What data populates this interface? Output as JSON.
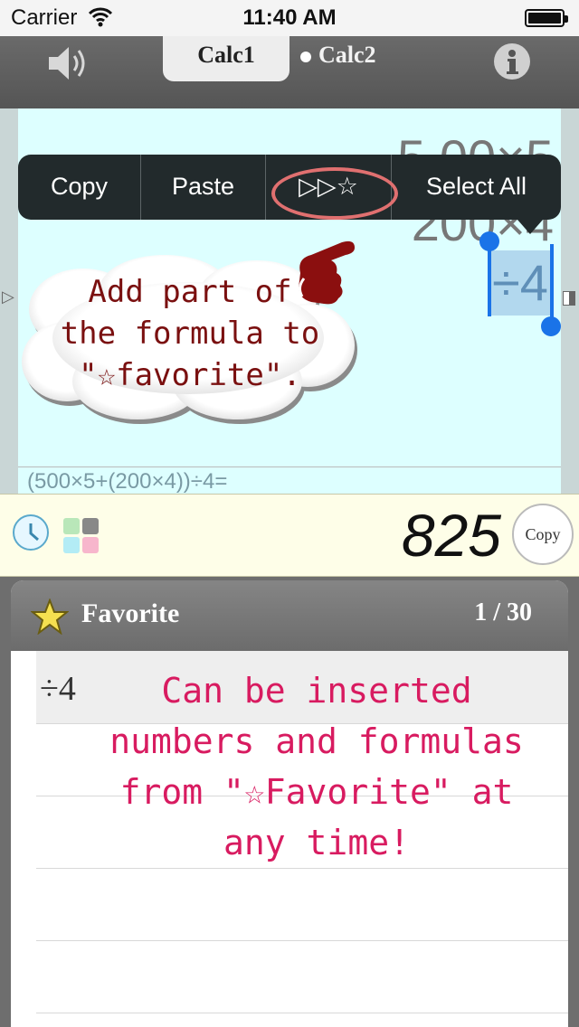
{
  "status_bar": {
    "carrier": "Carrier",
    "time": "11:40 AM"
  },
  "top_bar": {
    "tabs": [
      {
        "label": "Calc1",
        "active": true
      },
      {
        "label": "Calc2",
        "active": false
      }
    ]
  },
  "display": {
    "line1": "5.00×5",
    "line2": "200×4",
    "selection": "÷4",
    "formula": "(500×5+(200×4))÷4="
  },
  "context_menu": {
    "items": [
      "Copy",
      "Paste",
      "▷▷☆",
      "Select All"
    ]
  },
  "callout": {
    "line1": "Add  part of",
    "line2": "the formula to",
    "line3": "\"☆favorite\"."
  },
  "result": {
    "value": "825",
    "copy_label": "Copy"
  },
  "favorite": {
    "title": "Favorite",
    "count": "1 / 30",
    "items": [
      "÷4"
    ],
    "note_lines": [
      "Can be inserted",
      "numbers and formulas",
      "from \"☆Favorite\"  at",
      "any time!"
    ]
  },
  "colors": {
    "accent_menu": "#222a2c",
    "callout_text": "#7a1010",
    "note_text": "#d81b60",
    "display_bg": "#ddffff"
  }
}
